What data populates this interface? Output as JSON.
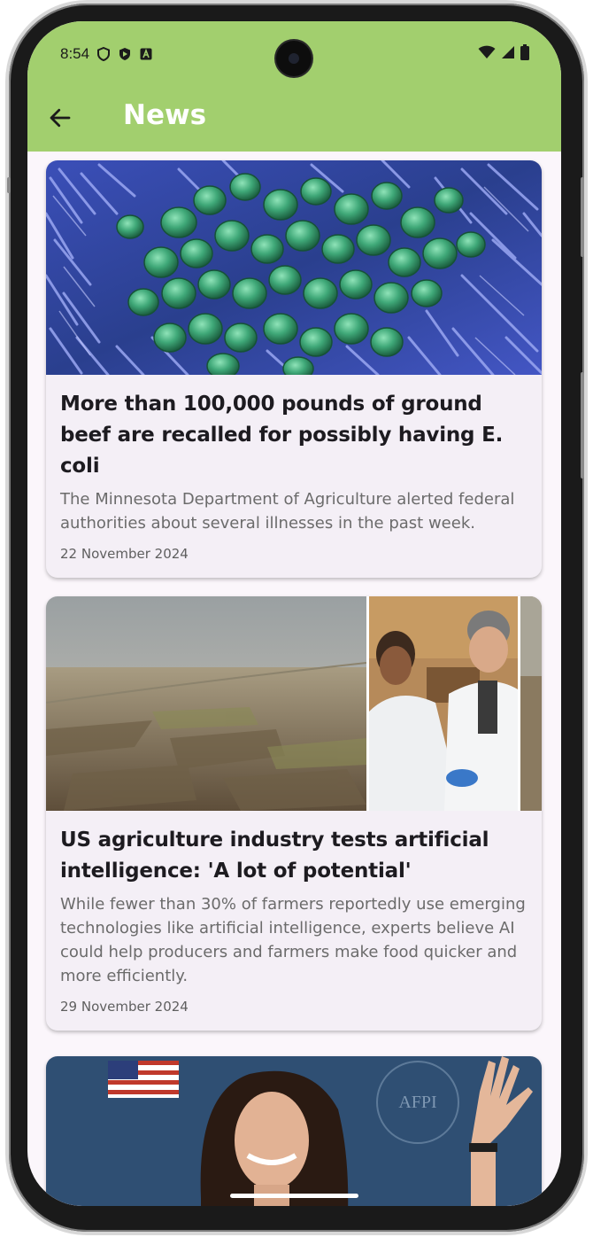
{
  "status_bar": {
    "time": "8:54"
  },
  "app_bar": {
    "title": "News",
    "back_icon": "arrow-back-icon",
    "color": "#a2cf6e"
  },
  "articles": [
    {
      "title": "More than 100,000 pounds of ground beef are recalled for possibly having E. coli",
      "summary": "The Minnesota Department of Agriculture alerted federal authorities about several illnesses in the past week.",
      "date": "22 November 2024",
      "image": "bacteria-micrograph"
    },
    {
      "title": "US agriculture industry tests artificial intelligence: 'A lot of potential'",
      "summary": "While fewer than 30% of farmers reportedly use emerging technologies like artificial intelligence, experts believe AI could help producers and farmers make food quicker and more efficiently.",
      "date": "29 November 2024",
      "image": "farmland-and-scientists"
    },
    {
      "image": "speaker-at-podium",
      "image_text": "AFPI"
    }
  ]
}
